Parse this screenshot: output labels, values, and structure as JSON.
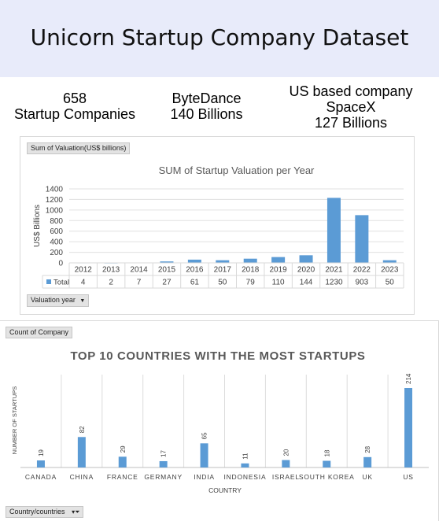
{
  "title": "Unicorn Startup Company Dataset",
  "stats": [
    {
      "line1": "658",
      "line2": "Startup Companies"
    },
    {
      "line1": "ByteDance",
      "line2": "140 Billions"
    },
    {
      "line1": "US based company",
      "line2": "SpaceX",
      "line3": "127 Billions"
    }
  ],
  "panel1": {
    "field_value": "Sum of Valuation(US$ billions)",
    "field_axis": "Valuation year"
  },
  "panel2": {
    "field_value": "Count of Company",
    "field_axis": "Country/countries"
  },
  "colors": {
    "bar": "#5b9bd5",
    "header_bg": "#e8ebfa"
  },
  "chart_data": [
    {
      "type": "bar",
      "title": "SUM of Startup Valuation per Year",
      "ylabel": "US$ Billions",
      "xlabel": "",
      "ylim": [
        0,
        1400
      ],
      "yticks": [
        0,
        200,
        400,
        600,
        800,
        1000,
        1200,
        1400
      ],
      "grid": true,
      "categories": [
        "2012",
        "2013",
        "2014",
        "2015",
        "2016",
        "2017",
        "2018",
        "2019",
        "2020",
        "2021",
        "2022",
        "2023"
      ],
      "series": [
        {
          "name": "Total",
          "values": [
            4,
            2,
            7,
            27,
            61,
            50,
            79,
            110,
            144,
            1230,
            903,
            50
          ]
        }
      ],
      "data_table": true
    },
    {
      "type": "bar",
      "title": "TOP 10 COUNTRIES WITH THE MOST STARTUPS",
      "ylabel": "NUMBER OF STARTUPS",
      "xlabel": "COUNTRY",
      "ylim": [
        0,
        214
      ],
      "grid": false,
      "categories": [
        "CANADA",
        "CHINA",
        "FRANCE",
        "GERMANY",
        "INDIA",
        "INDONESIA",
        "ISRAEL",
        "SOUTH KOREA",
        "UK",
        "US"
      ],
      "values": [
        19,
        82,
        29,
        17,
        65,
        11,
        20,
        18,
        28,
        214
      ]
    }
  ]
}
